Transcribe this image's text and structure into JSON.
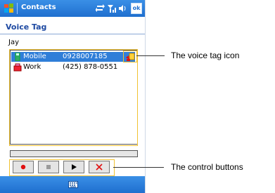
{
  "titlebar": {
    "app_title": "Contacts",
    "ok_label": "ok"
  },
  "header": {
    "subtitle": "Voice Tag"
  },
  "contact": {
    "name": "Jay"
  },
  "phones": [
    {
      "label": "Mobile",
      "number": "0928007185",
      "selected": true,
      "has_voice_tag": true
    },
    {
      "label": "Work",
      "number": "(425) 878-0551",
      "selected": false,
      "has_voice_tag": false
    }
  ],
  "controls": [
    {
      "name": "record-icon"
    },
    {
      "name": "stop-icon"
    },
    {
      "name": "play-icon"
    },
    {
      "name": "delete-icon"
    }
  ],
  "callouts": {
    "voice_tag_icon": "The voice tag icon",
    "control_buttons": "The control buttons"
  },
  "colors": {
    "title_bar": "#2a7fdd",
    "selection": "#2f7ed8",
    "callout_outline": "#f1c232",
    "record_red": "#e01010"
  }
}
